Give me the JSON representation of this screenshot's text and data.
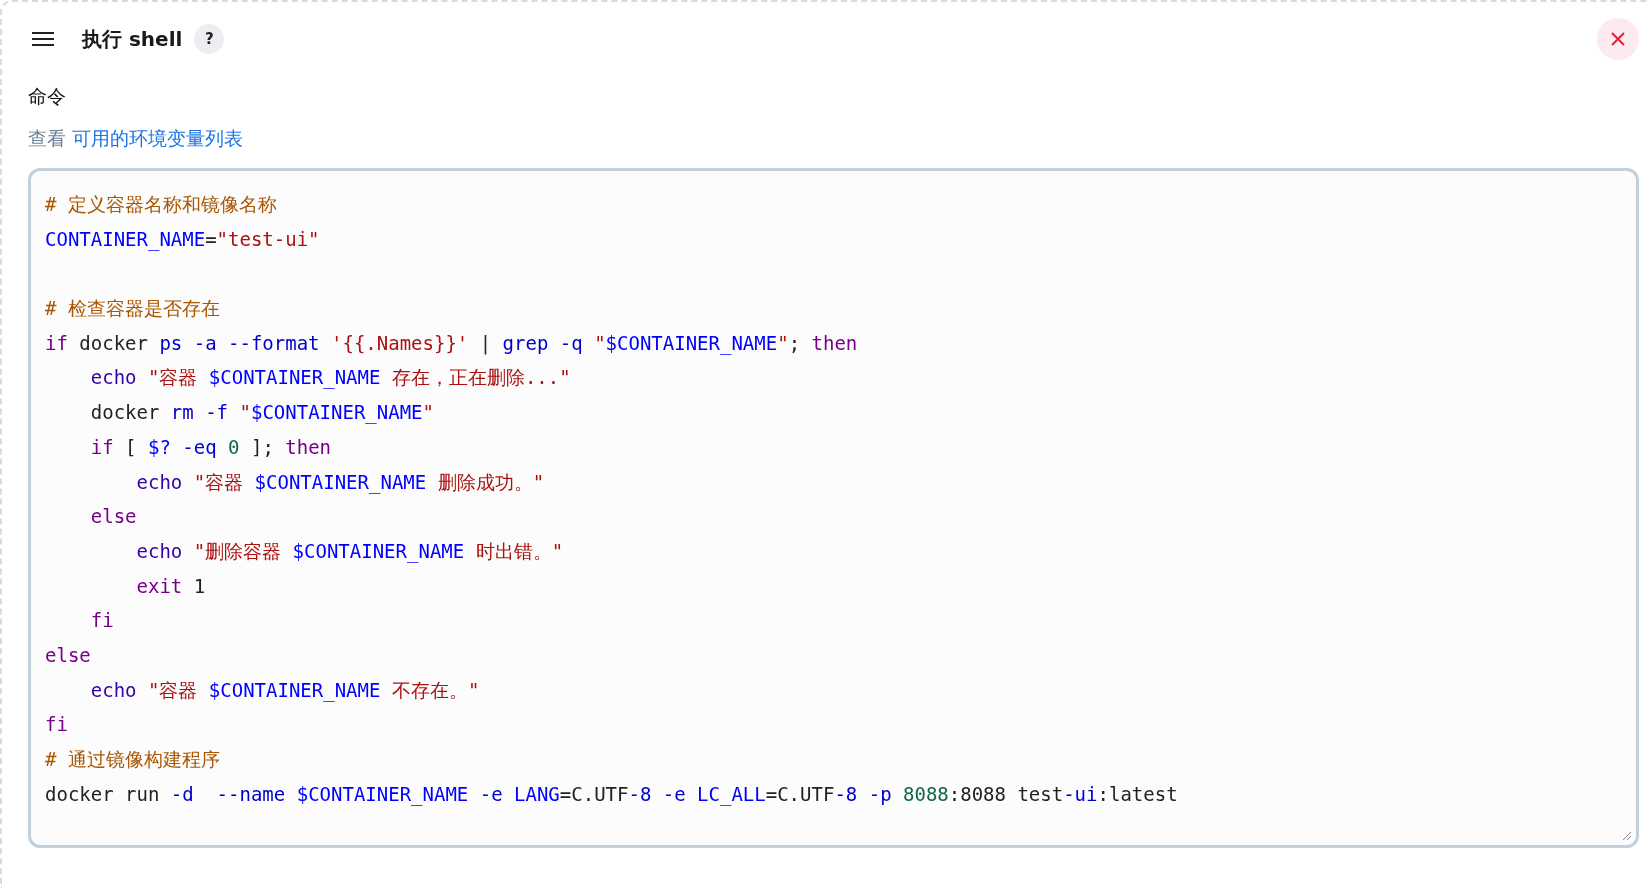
{
  "step": {
    "title": "执行 shell",
    "help": "?"
  },
  "field": {
    "label": "命令",
    "hint": "查看",
    "link": "可用的环境变量列表"
  },
  "editor": {
    "lines": [
      {
        "kind": "code",
        "tokens": [
          {
            "text": "# 定义容器名称和镜像名称",
            "kind": "comment"
          }
        ]
      },
      {
        "kind": "code",
        "tokens": [
          {
            "text": "CONTAINER_NAME",
            "kind": "variable"
          },
          {
            "text": "=",
            "kind": "plain"
          },
          {
            "text": "\"test-ui\"",
            "kind": "string"
          }
        ]
      },
      {
        "kind": "blank"
      },
      {
        "kind": "code",
        "tokens": [
          {
            "text": "# 检查容器是否存在",
            "kind": "comment"
          }
        ]
      },
      {
        "kind": "code",
        "tokens": [
          {
            "text": "if",
            "kind": "keyword"
          },
          {
            "text": " docker ",
            "kind": "plain"
          },
          {
            "text": "ps -a --format ",
            "kind": "attribute"
          },
          {
            "text": "'{{.Names}}'",
            "kind": "string"
          },
          {
            "text": " | ",
            "kind": "plain"
          },
          {
            "text": "grep -q ",
            "kind": "attribute"
          },
          {
            "text": "\"",
            "kind": "string"
          },
          {
            "text": "$CONTAINER_NAME",
            "kind": "variable"
          },
          {
            "text": "\"",
            "kind": "string"
          },
          {
            "text": "; ",
            "kind": "plain"
          },
          {
            "text": "then",
            "kind": "keyword"
          }
        ]
      },
      {
        "kind": "code",
        "tokens": [
          {
            "text": "    echo ",
            "kind": "builtin"
          },
          {
            "text": "\"容器 ",
            "kind": "string"
          },
          {
            "text": "$CONTAINER_NAME",
            "kind": "variable"
          },
          {
            "text": " 存在，正在删除...\"",
            "kind": "string"
          }
        ]
      },
      {
        "kind": "code",
        "tokens": [
          {
            "text": "    docker ",
            "kind": "plain"
          },
          {
            "text": "rm -f ",
            "kind": "attribute"
          },
          {
            "text": "\"",
            "kind": "string"
          },
          {
            "text": "$CONTAINER_NAME",
            "kind": "variable"
          },
          {
            "text": "\"",
            "kind": "string"
          }
        ]
      },
      {
        "kind": "code",
        "tokens": [
          {
            "text": "    if",
            "kind": "keyword"
          },
          {
            "text": " [ ",
            "kind": "plain"
          },
          {
            "text": "$? ",
            "kind": "variable"
          },
          {
            "text": "-eq ",
            "kind": "attribute"
          },
          {
            "text": "0",
            "kind": "number"
          },
          {
            "text": " ]; ",
            "kind": "plain"
          },
          {
            "text": "then",
            "kind": "keyword"
          }
        ]
      },
      {
        "kind": "code",
        "tokens": [
          {
            "text": "        echo ",
            "kind": "builtin"
          },
          {
            "text": "\"容器 ",
            "kind": "string"
          },
          {
            "text": "$CONTAINER_NAME",
            "kind": "variable"
          },
          {
            "text": " 删除成功。\"",
            "kind": "string"
          }
        ]
      },
      {
        "kind": "code",
        "tokens": [
          {
            "text": "    else",
            "kind": "keyword"
          }
        ]
      },
      {
        "kind": "code",
        "tokens": [
          {
            "text": "        echo ",
            "kind": "builtin"
          },
          {
            "text": "\"删除容器 ",
            "kind": "string"
          },
          {
            "text": "$CONTAINER_NAME",
            "kind": "variable"
          },
          {
            "text": " 时出错。\"",
            "kind": "string"
          }
        ]
      },
      {
        "kind": "code",
        "tokens": [
          {
            "text": "        exit",
            "kind": "keyword"
          },
          {
            "text": " 1",
            "kind": "plain"
          }
        ]
      },
      {
        "kind": "code",
        "tokens": [
          {
            "text": "    fi",
            "kind": "keyword"
          }
        ]
      },
      {
        "kind": "code",
        "tokens": [
          {
            "text": "else",
            "kind": "keyword"
          }
        ]
      },
      {
        "kind": "code",
        "tokens": [
          {
            "text": "    echo ",
            "kind": "builtin"
          },
          {
            "text": "\"容器 ",
            "kind": "string"
          },
          {
            "text": "$CONTAINER_NAME",
            "kind": "variable"
          },
          {
            "text": " 不存在。\"",
            "kind": "string"
          }
        ]
      },
      {
        "kind": "code",
        "tokens": [
          {
            "text": "fi",
            "kind": "keyword"
          }
        ]
      },
      {
        "kind": "code",
        "tokens": [
          {
            "text": "# 通过镜像构建程序",
            "kind": "comment"
          }
        ]
      },
      {
        "kind": "code",
        "tokens": [
          {
            "text": "docker run ",
            "kind": "plain"
          },
          {
            "text": "-d  --name ",
            "kind": "attribute"
          },
          {
            "text": "$CONTAINER_NAME ",
            "kind": "variable"
          },
          {
            "text": "-e ",
            "kind": "attribute"
          },
          {
            "text": "LANG",
            "kind": "variable"
          },
          {
            "text": "=C.UTF",
            "kind": "plain"
          },
          {
            "text": "-8 -e ",
            "kind": "attribute"
          },
          {
            "text": "LC_ALL",
            "kind": "variable"
          },
          {
            "text": "=C.UTF",
            "kind": "plain"
          },
          {
            "text": "-8 -p ",
            "kind": "attribute"
          },
          {
            "text": "8088",
            "kind": "number"
          },
          {
            "text": ":8088 test",
            "kind": "plain"
          },
          {
            "text": "-ui",
            "kind": "attribute"
          },
          {
            "text": ":latest",
            "kind": "plain"
          }
        ]
      }
    ]
  }
}
